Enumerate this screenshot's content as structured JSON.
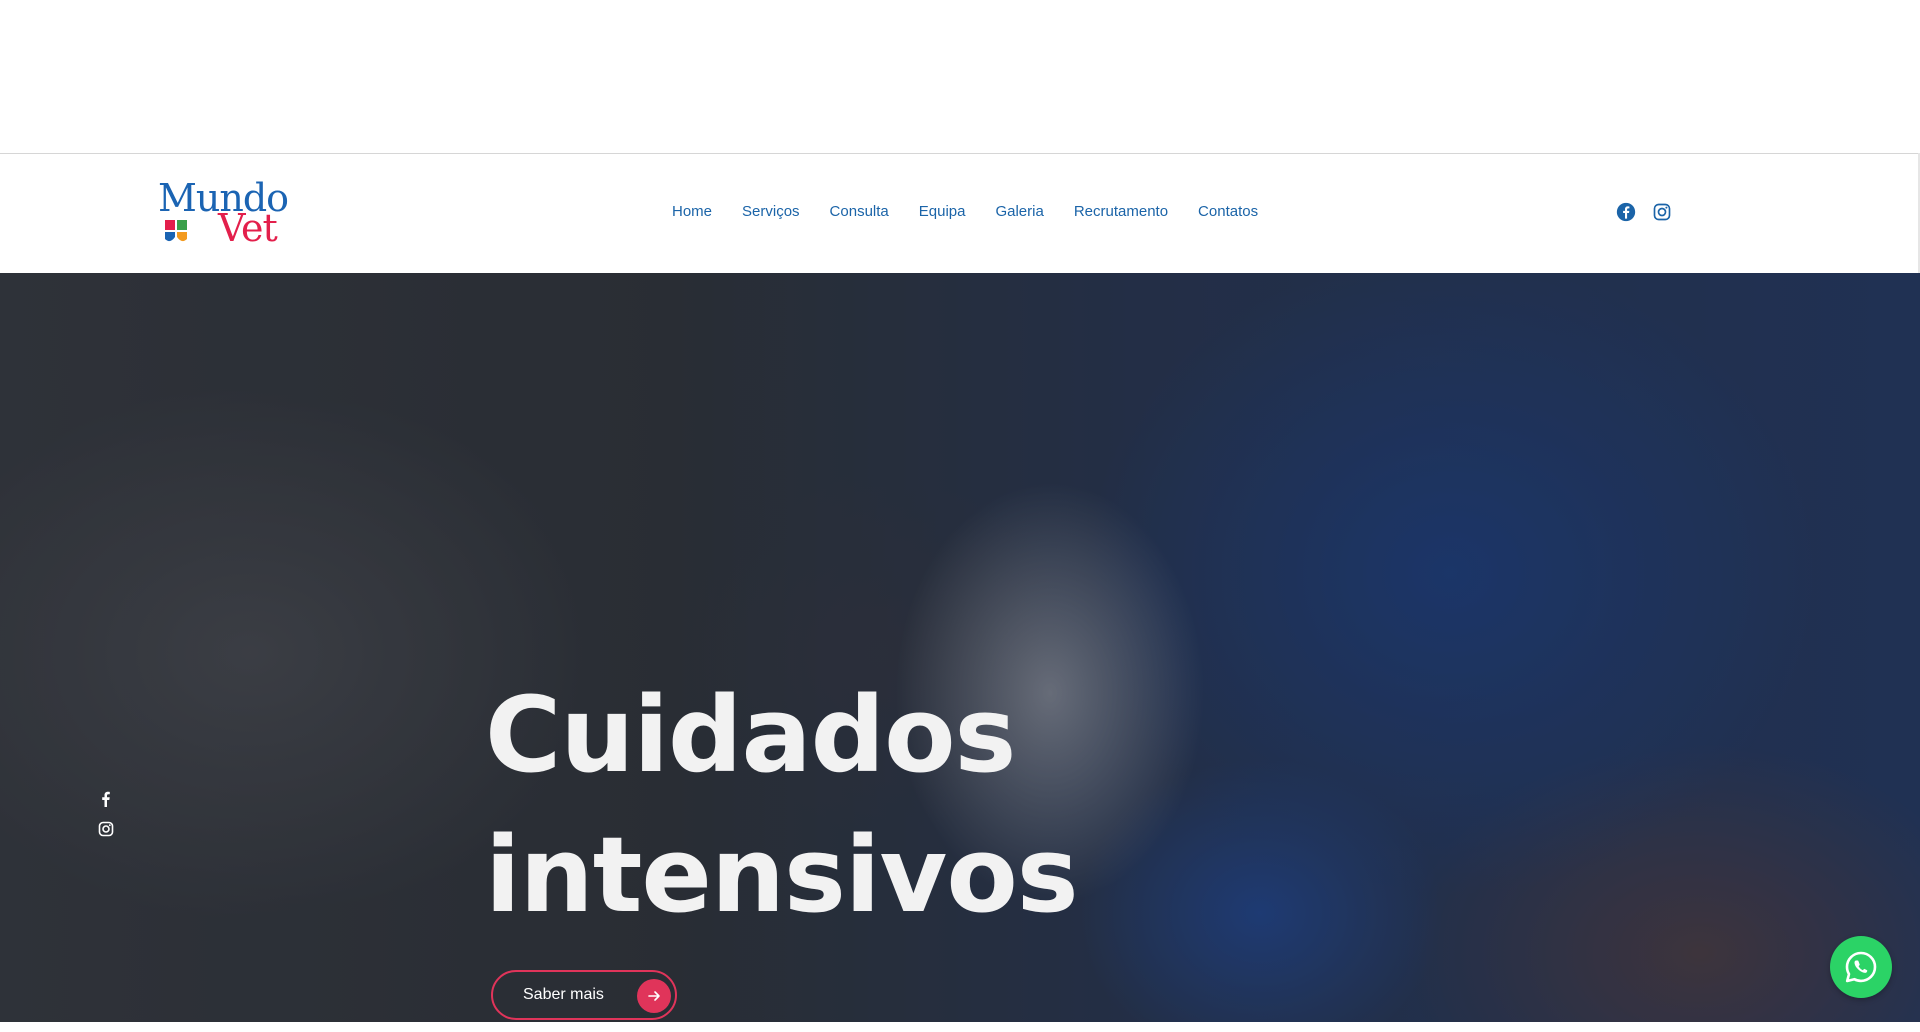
{
  "logo": {
    "word1": "Mundo",
    "word2": "Vet"
  },
  "nav": {
    "items": [
      {
        "label": "Home"
      },
      {
        "label": "Serviços"
      },
      {
        "label": "Consulta"
      },
      {
        "label": "Equipa"
      },
      {
        "label": "Galeria"
      },
      {
        "label": "Recrutamento"
      },
      {
        "label": "Contatos"
      }
    ]
  },
  "header_social": {
    "icons": [
      "facebook-icon",
      "instagram-icon"
    ]
  },
  "hero": {
    "title_line1": "Cuidados",
    "title_line2": "intensivos",
    "cta_label": "Saber mais",
    "social_icons": [
      "facebook-icon",
      "instagram-icon"
    ]
  },
  "colors": {
    "nav_text": "#1b64a8",
    "accent": "#e0345a",
    "whatsapp": "#2bd366"
  }
}
